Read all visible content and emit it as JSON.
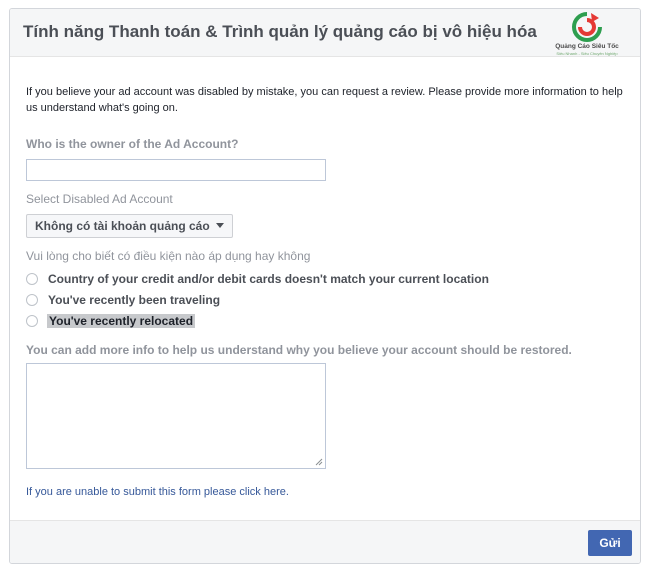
{
  "header": {
    "title": "Tính năng Thanh toán & Trình quản lý quảng cáo bị vô hiệu hóa",
    "logo": {
      "name": "Quảng Cáo Siêu Tốc",
      "tagline": "Siêu Nhanh - Siêu Chuyên Nghiệp",
      "colors": [
        "#2e9e4f",
        "#e53935"
      ]
    }
  },
  "form": {
    "intro": "If you believe your ad account was disabled by mistake, you can request a review. Please provide more information to help us understand what's going on.",
    "owner_label": "Who is the owner of the Ad Account?",
    "owner_value": "",
    "account_label": "Select Disabled Ad Account",
    "account_selected": "Không có tài khoản quảng cáo",
    "conditions_label": "Vui lòng cho biết có điều kiện nào áp dụng hay không",
    "conditions": [
      {
        "label": "Country of your credit and/or debit cards doesn't match your current location"
      },
      {
        "label": "You've recently been traveling"
      },
      {
        "label": "You've recently relocated"
      }
    ],
    "more_info_label": "You can add more info to help us understand why you believe your account should be restored.",
    "more_info_value": "",
    "help_link": "If you are unable to submit this form please click here."
  },
  "footer": {
    "submit_label": "Gửi"
  },
  "colors": {
    "accent": "#4267b2",
    "link": "#365899",
    "label_gray": "#90949c"
  }
}
